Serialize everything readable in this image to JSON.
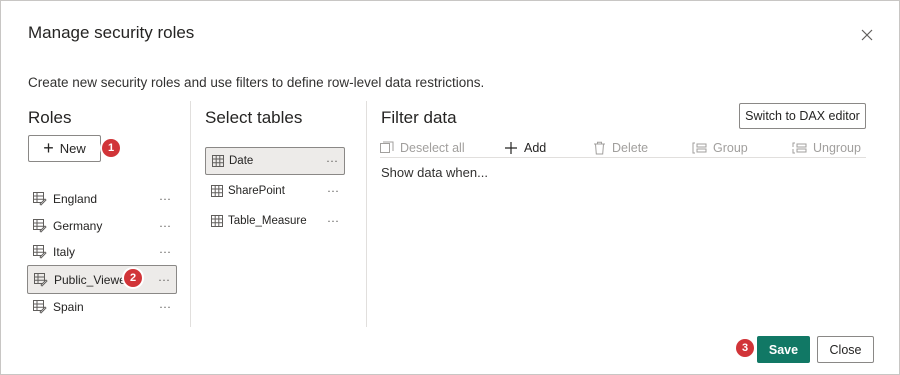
{
  "dialog": {
    "title": "Manage security roles",
    "subtitle": "Create new security roles and use filters to define row-level data restrictions."
  },
  "roles": {
    "heading": "Roles",
    "new_label": "New",
    "items": [
      {
        "label": "England",
        "more": "···"
      },
      {
        "label": "Germany",
        "more": "···"
      },
      {
        "label": "Italy",
        "more": "···"
      },
      {
        "label": "Public_Viewer",
        "more": "···",
        "selected": true
      },
      {
        "label": "Spain",
        "more": "···"
      }
    ]
  },
  "tables": {
    "heading": "Select tables",
    "items": [
      {
        "label": "Date",
        "more": "···",
        "selected": true
      },
      {
        "label": "SharePoint",
        "more": "···"
      },
      {
        "label": "Table_Measure",
        "more": "···"
      }
    ]
  },
  "filter": {
    "heading": "Filter data",
    "dax_label": "Switch to DAX editor",
    "toolbar": {
      "deselect_all": "Deselect all",
      "add": "Add",
      "delete": "Delete",
      "group": "Group",
      "ungroup": "Ungroup"
    },
    "show_data": "Show data when..."
  },
  "footer": {
    "save_label": "Save",
    "close_label": "Close"
  },
  "badges": {
    "new": "1",
    "role": "2",
    "save": "3"
  },
  "colors": {
    "accent": "#117865",
    "badge": "#d13438",
    "selected_bg": "#edebe9"
  },
  "icons": {
    "role_item": "role-table-edit-icon",
    "table_item": "table-grid-icon"
  }
}
